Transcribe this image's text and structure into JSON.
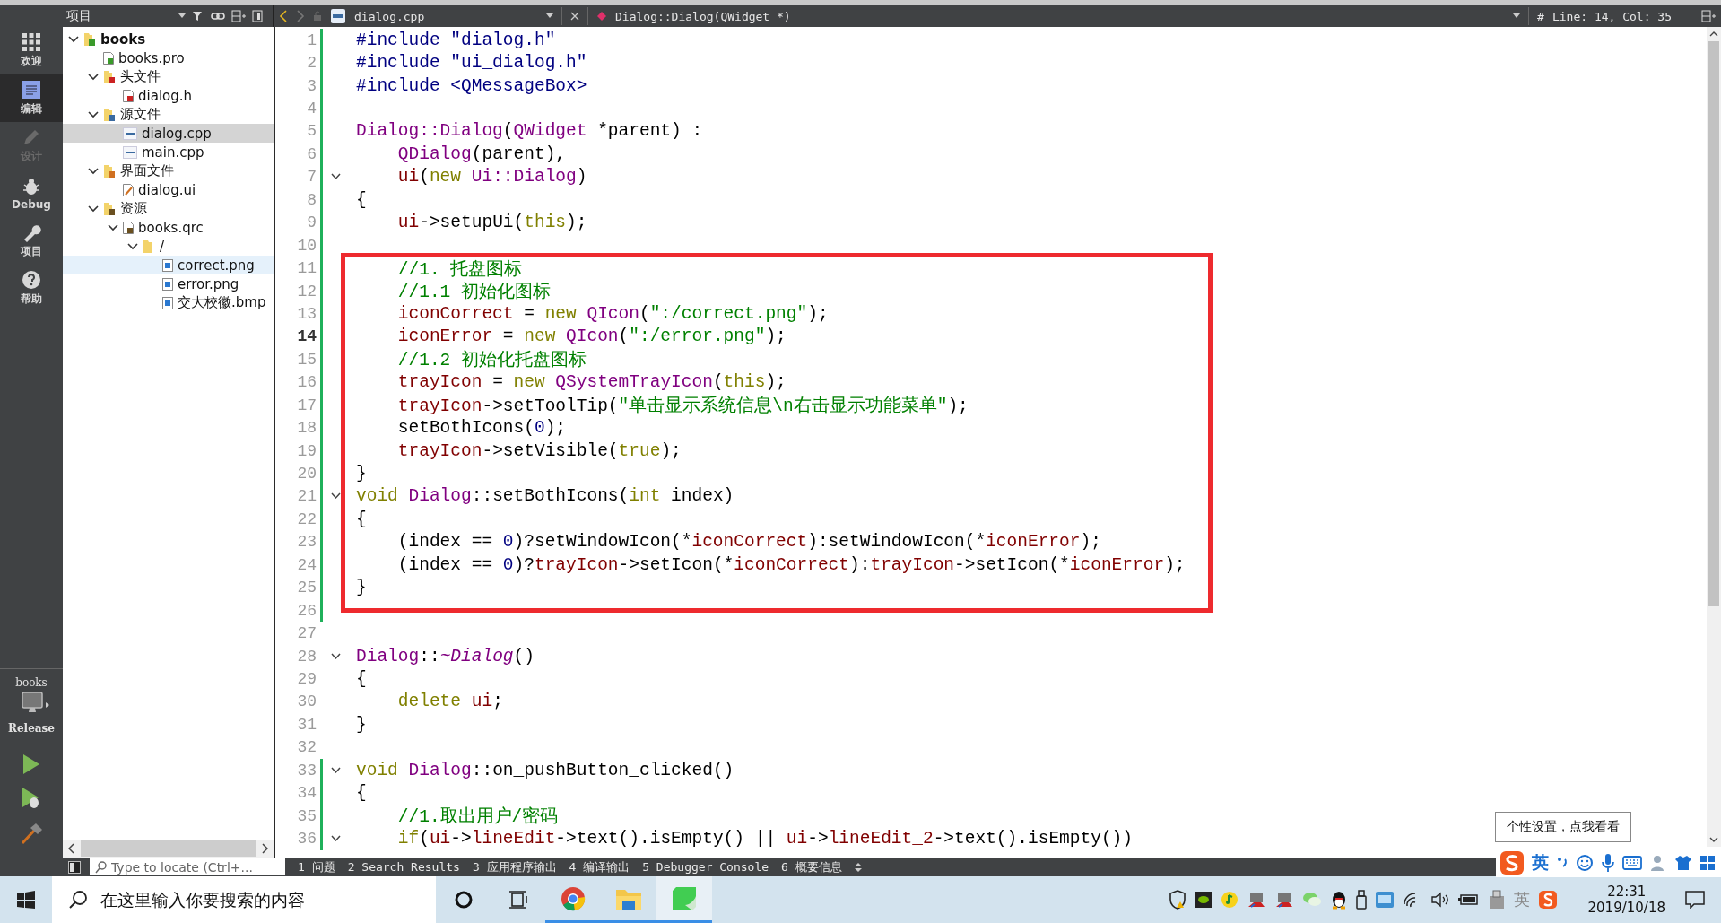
{
  "toolbar": {
    "panel_title": "项目",
    "file": "dialog.cpp",
    "symbol": "Dialog::Dialog(QWidget *)",
    "hash": "#",
    "position": "Line: 14, Col: 35"
  },
  "modes": [
    {
      "label": "欢迎",
      "kind": "welcome",
      "selected": false,
      "disabled": false
    },
    {
      "label": "编辑",
      "kind": "edit",
      "selected": true,
      "disabled": false
    },
    {
      "label": "设计",
      "kind": "design",
      "selected": false,
      "disabled": true
    },
    {
      "label": "Debug",
      "kind": "debug",
      "selected": false,
      "disabled": false
    },
    {
      "label": "项目",
      "kind": "projects",
      "selected": false,
      "disabled": false
    },
    {
      "label": "帮助",
      "kind": "help",
      "selected": false,
      "disabled": false
    }
  ],
  "kit": {
    "project": "books",
    "build": "Release"
  },
  "tree": [
    {
      "label": "books",
      "kind": "project",
      "expanded": true,
      "selected": false,
      "hovered": false,
      "children": [
        {
          "label": "books.pro",
          "kind": "pro",
          "selected": false,
          "hovered": false
        },
        {
          "label": "头文件",
          "kind": "folder-h",
          "expanded": true,
          "selected": false,
          "hovered": false,
          "children": [
            {
              "label": "dialog.h",
              "kind": "header",
              "selected": false,
              "hovered": false
            }
          ]
        },
        {
          "label": "源文件",
          "kind": "folder-src",
          "expanded": true,
          "selected": false,
          "hovered": false,
          "children": [
            {
              "label": "dialog.cpp",
              "kind": "cpp",
              "selected": true,
              "hovered": false
            },
            {
              "label": "main.cpp",
              "kind": "cpp",
              "selected": false,
              "hovered": false
            }
          ]
        },
        {
          "label": "界面文件",
          "kind": "folder-ui",
          "expanded": true,
          "selected": false,
          "hovered": false,
          "children": [
            {
              "label": "dialog.ui",
              "kind": "ui",
              "selected": false,
              "hovered": false
            }
          ]
        },
        {
          "label": "资源",
          "kind": "folder-res",
          "expanded": true,
          "selected": false,
          "hovered": false,
          "children": [
            {
              "label": "books.qrc",
              "kind": "qrc",
              "expanded": true,
              "selected": false,
              "hovered": false,
              "children": [
                {
                  "label": "/",
                  "kind": "folder",
                  "expanded": true,
                  "selected": false,
                  "hovered": false,
                  "children": [
                    {
                      "label": "correct.png",
                      "kind": "image",
                      "selected": false,
                      "hovered": true
                    },
                    {
                      "label": "error.png",
                      "kind": "image",
                      "selected": false,
                      "hovered": false
                    },
                    {
                      "label": "交大校徽.bmp",
                      "kind": "image",
                      "selected": false,
                      "hovered": false
                    }
                  ]
                }
              ]
            }
          ]
        }
      ]
    }
  ],
  "code_blocks": [
    {
      "boxed": false,
      "lines": [
        {
          "number": "1",
          "changed": true,
          "fold": false,
          "current": false,
          "tokens": [
            {
              "text": "#include \"dialog.h\"",
              "kind": "pp"
            }
          ]
        },
        {
          "number": "2",
          "changed": true,
          "fold": false,
          "current": false,
          "tokens": [
            {
              "text": "#include \"ui_dialog.h\"",
              "kind": "pp"
            }
          ]
        },
        {
          "number": "3",
          "changed": true,
          "fold": false,
          "current": false,
          "tokens": [
            {
              "text": "#include <QMessageBox>",
              "kind": "pp"
            }
          ]
        },
        {
          "number": "4",
          "changed": true,
          "fold": false,
          "current": false
        },
        {
          "number": "5",
          "changed": true,
          "fold": false,
          "current": false,
          "tokens": [
            {
              "text": "Dialog::Dialog",
              "kind": "cls"
            },
            {
              "text": "(",
              "kind": "plain"
            },
            {
              "text": "QWidget",
              "kind": "cls"
            },
            {
              "text": " *parent) :",
              "kind": "plain"
            }
          ]
        },
        {
          "number": "6",
          "changed": true,
          "fold": false,
          "current": false,
          "tokens": [
            {
              "text": "    QDialog",
              "kind": "cls"
            },
            {
              "text": "(parent),",
              "kind": "plain"
            }
          ]
        },
        {
          "number": "7",
          "changed": true,
          "fold": true,
          "current": false,
          "tokens": [
            {
              "text": "    ui",
              "kind": "mem"
            },
            {
              "text": "(",
              "kind": "plain"
            },
            {
              "text": "new",
              "kind": "kw"
            },
            {
              "text": " Ui::Dialog",
              "kind": "cls"
            },
            {
              "text": ")",
              "kind": "plain"
            }
          ]
        },
        {
          "number": "8",
          "changed": true,
          "fold": false,
          "current": false,
          "tokens": [
            {
              "text": "{",
              "kind": "plain"
            }
          ]
        },
        {
          "number": "9",
          "changed": true,
          "fold": false,
          "current": false,
          "tokens": [
            {
              "text": "    ui",
              "kind": "mem"
            },
            {
              "text": "->setupUi(",
              "kind": "plain"
            },
            {
              "text": "this",
              "kind": "kw"
            },
            {
              "text": ");",
              "kind": "plain"
            }
          ]
        },
        {
          "number": "10",
          "changed": true,
          "fold": false,
          "current": false
        }
      ]
    },
    {
      "boxed": true,
      "lines": [
        {
          "number": "11",
          "changed": true,
          "fold": false,
          "current": false,
          "tokens": [
            {
              "text": "    //1. 托盘图标",
              "kind": "com"
            }
          ]
        },
        {
          "number": "12",
          "changed": true,
          "fold": false,
          "current": false,
          "tokens": [
            {
              "text": "    //1.1 初始化图标",
              "kind": "com"
            }
          ]
        },
        {
          "number": "13",
          "changed": true,
          "fold": false,
          "current": false,
          "tokens": [
            {
              "text": "    iconCorrect",
              "kind": "mem"
            },
            {
              "text": " = ",
              "kind": "plain"
            },
            {
              "text": "new",
              "kind": "kw"
            },
            {
              "text": " QIcon",
              "kind": "cls"
            },
            {
              "text": "(",
              "kind": "plain"
            },
            {
              "text": "\":/correct.png\"",
              "kind": "str"
            },
            {
              "text": ");",
              "kind": "plain"
            }
          ]
        },
        {
          "number": "14",
          "changed": true,
          "fold": false,
          "current": true,
          "tokens": [
            {
              "text": "    iconError",
              "kind": "mem"
            },
            {
              "text": " = ",
              "kind": "plain"
            },
            {
              "text": "new",
              "kind": "kw"
            },
            {
              "text": " QIcon",
              "kind": "cls"
            },
            {
              "text": "(",
              "kind": "plain"
            },
            {
              "text": "\":/error.png\"",
              "kind": "str"
            },
            {
              "text": ");",
              "kind": "plain"
            }
          ]
        },
        {
          "number": "15",
          "changed": true,
          "fold": false,
          "current": false,
          "tokens": [
            {
              "text": "    //1.2 初始化托盘图标",
              "kind": "com"
            }
          ]
        },
        {
          "number": "16",
          "changed": true,
          "fold": false,
          "current": false,
          "tokens": [
            {
              "text": "    trayIcon",
              "kind": "mem"
            },
            {
              "text": " = ",
              "kind": "plain"
            },
            {
              "text": "new",
              "kind": "kw"
            },
            {
              "text": " QSystemTrayIcon",
              "kind": "cls"
            },
            {
              "text": "(",
              "kind": "plain"
            },
            {
              "text": "this",
              "kind": "kw"
            },
            {
              "text": ");",
              "kind": "plain"
            }
          ]
        },
        {
          "number": "17",
          "changed": true,
          "fold": false,
          "current": false,
          "tokens": [
            {
              "text": "    trayIcon",
              "kind": "mem"
            },
            {
              "text": "->setToolTip(",
              "kind": "plain"
            },
            {
              "text": "\"单击显示系统信息\\n右击显示功能菜单\"",
              "kind": "str"
            },
            {
              "text": ");",
              "kind": "plain"
            }
          ]
        },
        {
          "number": "18",
          "changed": true,
          "fold": false,
          "current": false,
          "tokens": [
            {
              "text": "    setBothIcons(",
              "kind": "plain"
            },
            {
              "text": "0",
              "kind": "num"
            },
            {
              "text": ");",
              "kind": "plain"
            }
          ]
        },
        {
          "number": "19",
          "changed": true,
          "fold": false,
          "current": false,
          "tokens": [
            {
              "text": "    trayIcon",
              "kind": "mem"
            },
            {
              "text": "->setVisible(",
              "kind": "plain"
            },
            {
              "text": "true",
              "kind": "kw"
            },
            {
              "text": ");",
              "kind": "plain"
            }
          ]
        },
        {
          "number": "20",
          "changed": true,
          "fold": false,
          "current": false,
          "tokens": [
            {
              "text": "}",
              "kind": "plain"
            }
          ]
        },
        {
          "number": "21",
          "changed": true,
          "fold": true,
          "current": false,
          "tokens": [
            {
              "text": "void",
              "kind": "kw"
            },
            {
              "text": " Dialog",
              "kind": "cls"
            },
            {
              "text": "::setBothIcons(",
              "kind": "plain"
            },
            {
              "text": "int",
              "kind": "kw"
            },
            {
              "text": " index)",
              "kind": "plain"
            }
          ]
        },
        {
          "number": "22",
          "changed": true,
          "fold": false,
          "current": false,
          "tokens": [
            {
              "text": "{",
              "kind": "plain"
            }
          ]
        },
        {
          "number": "23",
          "changed": true,
          "fold": false,
          "current": false,
          "tokens": [
            {
              "text": "    (index == ",
              "kind": "plain"
            },
            {
              "text": "0",
              "kind": "num"
            },
            {
              "text": ")?setWindowIcon(*",
              "kind": "plain"
            },
            {
              "text": "iconCorrect",
              "kind": "mem"
            },
            {
              "text": "):setWindowIcon(*",
              "kind": "plain"
            },
            {
              "text": "iconError",
              "kind": "mem"
            },
            {
              "text": ");",
              "kind": "plain"
            }
          ]
        },
        {
          "number": "24",
          "changed": true,
          "fold": false,
          "current": false,
          "tokens": [
            {
              "text": "    (index == ",
              "kind": "plain"
            },
            {
              "text": "0",
              "kind": "num"
            },
            {
              "text": ")?",
              "kind": "plain"
            },
            {
              "text": "trayIcon",
              "kind": "mem"
            },
            {
              "text": "->setIcon(*",
              "kind": "plain"
            },
            {
              "text": "iconCorrect",
              "kind": "mem"
            },
            {
              "text": "):",
              "kind": "plain"
            },
            {
              "text": "trayIcon",
              "kind": "mem"
            },
            {
              "text": "->setIcon(*",
              "kind": "plain"
            },
            {
              "text": "iconError",
              "kind": "mem"
            },
            {
              "text": ");",
              "kind": "plain"
            }
          ]
        },
        {
          "number": "25",
          "changed": true,
          "fold": false,
          "current": false,
          "tokens": [
            {
              "text": "}",
              "kind": "plain"
            }
          ]
        },
        {
          "number": "26",
          "changed": true,
          "fold": false,
          "current": false
        }
      ]
    },
    {
      "boxed": false,
      "lines": [
        {
          "number": "27",
          "changed": false,
          "fold": false,
          "current": false
        },
        {
          "number": "28",
          "changed": false,
          "fold": true,
          "current": false,
          "tokens": [
            {
              "text": "Dialog",
              "kind": "cls"
            },
            {
              "text": "::",
              "kind": "plain"
            },
            {
              "text": "~Dialog",
              "kind": "ital"
            },
            {
              "text": "()",
              "kind": "plain"
            }
          ]
        },
        {
          "number": "29",
          "changed": false,
          "fold": false,
          "current": false,
          "tokens": [
            {
              "text": "{",
              "kind": "plain"
            }
          ]
        },
        {
          "number": "30",
          "changed": false,
          "fold": false,
          "current": false,
          "tokens": [
            {
              "text": "    delete",
              "kind": "kw"
            },
            {
              "text": " ui",
              "kind": "mem"
            },
            {
              "text": ";",
              "kind": "plain"
            }
          ]
        },
        {
          "number": "31",
          "changed": false,
          "fold": false,
          "current": false,
          "tokens": [
            {
              "text": "}",
              "kind": "plain"
            }
          ]
        },
        {
          "number": "32",
          "changed": false,
          "fold": false,
          "current": false
        },
        {
          "number": "33",
          "changed": true,
          "fold": true,
          "current": false,
          "tokens": [
            {
              "text": "void",
              "kind": "kw"
            },
            {
              "text": " Dialog",
              "kind": "cls"
            },
            {
              "text": "::on_pushButton_clicked()",
              "kind": "plain"
            }
          ]
        },
        {
          "number": "34",
          "changed": true,
          "fold": false,
          "current": false,
          "tokens": [
            {
              "text": "{",
              "kind": "plain"
            }
          ]
        },
        {
          "number": "35",
          "changed": true,
          "fold": false,
          "current": false,
          "tokens": [
            {
              "text": "    //1.取出用户/密码",
              "kind": "com"
            }
          ]
        },
        {
          "number": "36",
          "changed": true,
          "fold": true,
          "current": false,
          "tokens": [
            {
              "text": "    if",
              "kind": "kw"
            },
            {
              "text": "(",
              "kind": "plain"
            },
            {
              "text": "ui",
              "kind": "mem"
            },
            {
              "text": "->",
              "kind": "plain"
            },
            {
              "text": "lineEdit",
              "kind": "mem"
            },
            {
              "text": "->text().isEmpty() || ",
              "kind": "plain"
            },
            {
              "text": "ui",
              "kind": "mem"
            },
            {
              "text": "->",
              "kind": "plain"
            },
            {
              "text": "lineEdit_2",
              "kind": "mem"
            },
            {
              "text": "->text().isEmpty())",
              "kind": "plain"
            }
          ]
        }
      ]
    }
  ],
  "output_panes": {
    "locate_placeholder": "Type to locate (Ctrl+...",
    "tabs": [
      "1 问题",
      "2 Search Results",
      "3 应用程序输出",
      "4 编译输出",
      "5 Debugger Console",
      "6 概要信息"
    ]
  },
  "ime": {
    "tooltip": "个性设置，点我看看",
    "mode": "英"
  },
  "taskbar": {
    "search_placeholder": "在这里输入你要搜索的内容",
    "apps": [
      {
        "kind": "browser",
        "running": true,
        "active": false
      },
      {
        "kind": "files",
        "running": true,
        "active": false
      },
      {
        "kind": "qt",
        "running": true,
        "active": true
      }
    ],
    "tray_ime": "英",
    "time": "22:31",
    "date": "2019/10/18"
  }
}
